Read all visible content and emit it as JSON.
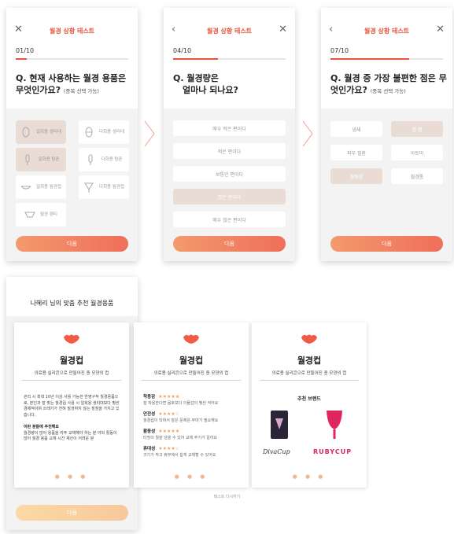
{
  "screen1": {
    "title": "월경 상황 테스트",
    "step_current": "01",
    "step_total": "/10",
    "progress": 0.1,
    "question": "Q. 현재 사용하는 월경 용품은 무엇인가요?",
    "question_sub": "(중복 선택 가능)",
    "options": [
      {
        "label": "일회용 생리대",
        "selected": true
      },
      {
        "label": "다회용 생리대",
        "selected": false
      },
      {
        "label": "일회용 탐폰",
        "selected": true
      },
      {
        "label": "다회용 탐폰",
        "selected": false
      },
      {
        "label": "일회용 월경컵",
        "selected": false
      },
      {
        "label": "다회용 월경컵",
        "selected": false
      },
      {
        "label": "월경 팬티",
        "selected": false
      }
    ],
    "next": "다음"
  },
  "screen2": {
    "title": "월경 상황 테스트",
    "step_current": "04",
    "step_total": "/10",
    "progress": 0.4,
    "question_line1": "Q. 월경량은",
    "question_line2": "얼마나 되나요?",
    "options": [
      {
        "label": "매우 적은 편이다",
        "selected": false
      },
      {
        "label": "적은 편이다",
        "selected": false
      },
      {
        "label": "보통인 편이다",
        "selected": false
      },
      {
        "label": "많은 편이다",
        "selected": true
      },
      {
        "label": "매우 많은 편이다",
        "selected": false
      }
    ],
    "next": "다음"
  },
  "screen3": {
    "title": "월경 상황 테스트",
    "step_current": "07",
    "step_total": "/10",
    "progress": 0.7,
    "question": "Q. 월경 중 가장 불편한 점은 무엇인가요?",
    "question_sub": "(중복 선택 가능)",
    "options": [
      {
        "label": "냄새",
        "selected": false
      },
      {
        "label": "찝 찝",
        "selected": true
      },
      {
        "label": "피부 질환",
        "selected": false
      },
      {
        "label": "아토미",
        "selected": false
      },
      {
        "label": "찜찜함",
        "selected": true
      },
      {
        "label": "월경통",
        "selected": false
      }
    ],
    "next": "다음"
  },
  "result": {
    "title": "나혜리 님의 맞춤 추천 월경용품",
    "retry": "테스트 다시하기",
    "next": "다음",
    "cards": [
      {
        "title": "월경컵",
        "subtitle": "의료용 실리콘으로 만들어진 종 모양의 컵",
        "para1": "관리 시 최대 10년 이상 사용 가능한 반영구적 월경용품으로, 본인과 잘 맞는 월경컵 사용 시 일회용 생리대보다 훨씬 경제적이며 쓰레기가 전혀 발생하지 않는 장점을 가지고 있습니다.",
        "heading": "이런 분들에 추천해요",
        "para2": "월경량이 많아 용품을 자주 교체해야 하는 분 야외 활동이 많아 월경 용품 교체 시간 계산이 어려운 분"
      },
      {
        "title": "월경컵",
        "subtitle": "의료용 실리콘으로 만들어진 종 모양의 컵",
        "attributes": [
          {
            "name": "착용감",
            "stars": "★★★★★",
            "desc": "잘 착용한다면 몸호보다 이물감이 훨씬 적어요"
          },
          {
            "name": "안전성",
            "stars": "★★★★☆",
            "desc": "월경컵이 빅혀서 잘은 문제은 무마가 필요해요"
          },
          {
            "name": "활동성",
            "stars": "★★★★★",
            "desc": "타밍이 월을 넘을 수 있어 교체 주기가 길어요"
          },
          {
            "name": "휴대성",
            "stars": "★★★★☆",
            "desc": "크기가 작고 휴부에서 쉽게 교체할 수 있어요"
          }
        ]
      },
      {
        "title": "월경컵",
        "subtitle": "의료용 실리콘으로 만들어진 종 모양의 컵",
        "brand_heading": "추천 브랜드",
        "brands": [
          "DivaCup",
          "RUBYCUP"
        ]
      }
    ]
  },
  "colors": {
    "accent": "#e8553e",
    "selected": "#e9dcd4",
    "button_start": "#f29a6e",
    "button_end": "#f06f5a"
  }
}
